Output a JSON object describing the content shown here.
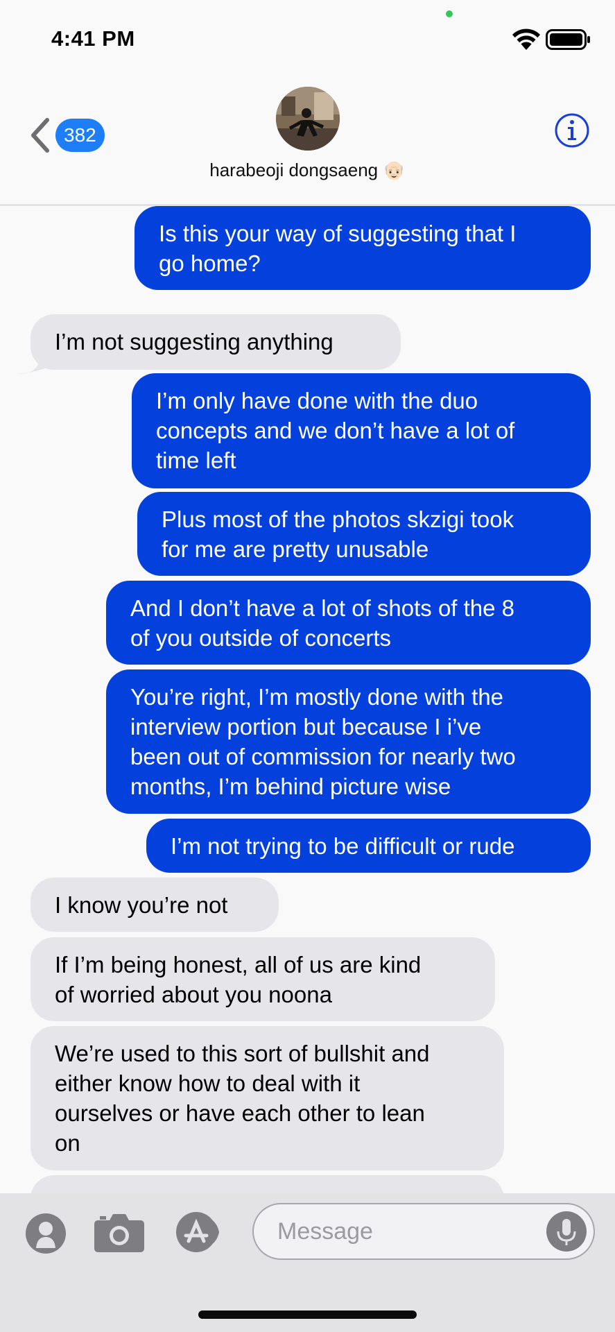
{
  "status_bar": {
    "time": "4:41 PM",
    "icons": [
      "wifi-icon",
      "battery-icon"
    ]
  },
  "header": {
    "back_badge": "382",
    "contact_name": "harabeoji dongsaeng 👴🏻",
    "info_icon": "info-icon",
    "avatar": "contact-photo"
  },
  "messages": [
    {
      "side": "sent",
      "text": "Is this your way of suggesting that I\ngo home?"
    },
    {
      "side": "received",
      "text": "I’m not suggesting anything"
    },
    {
      "side": "sent",
      "text": "I’m only have done with the duo\nconcepts and we don’t have a lot of\ntime left"
    },
    {
      "side": "sent",
      "text": "Plus most of the photos skzigi took\nfor me are pretty unusable"
    },
    {
      "side": "sent",
      "text": "And I don’t have a lot of shots of the 8\nof you outside of concerts"
    },
    {
      "side": "sent",
      "text": "You’re right, I’m mostly done with the\ninterview portion but because I i’ve\nbeen out of commission for nearly two\nmonths, I’m behind picture wise"
    },
    {
      "side": "sent",
      "text": "I’m not trying to be difficult or rude"
    },
    {
      "side": "received",
      "text": "I know you’re not"
    },
    {
      "side": "received",
      "text": "If I’m being honest, all of us are kind\nof worried about you noona"
    },
    {
      "side": "received",
      "text": "We’re used to this sort of bullshit and\neither know how to deal with it\nourselves or have each other to lean\non"
    },
    {
      "side": "received",
      "text": ""
    }
  ],
  "input_bar": {
    "placeholder": "Message",
    "buttons": [
      "memoji-icon",
      "camera-icon",
      "app-store-icon",
      "microphone-icon"
    ]
  },
  "colors": {
    "sent_bubble": "#0340dc",
    "received_bubble": "#e6e5ea",
    "badge": "#1e7ef7",
    "info": "#1a3fd6"
  }
}
